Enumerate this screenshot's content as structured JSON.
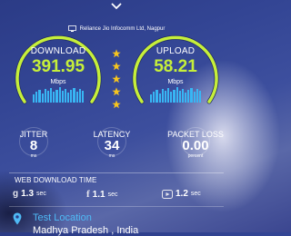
{
  "provider": {
    "name": "Reliance Jio Infocomm Ltd, Nagpur",
    "icon": "computer-icon"
  },
  "download": {
    "label": "DOWNLOAD",
    "value": "391.95",
    "unit": "Mbps",
    "color": "#c6ef3a"
  },
  "upload": {
    "label": "UPLOAD",
    "value": "58.21",
    "unit": "Mbps",
    "color": "#c6ef3a"
  },
  "rating": {
    "stars": 5,
    "color": "#f7c51e"
  },
  "metrics": {
    "jitter": {
      "label": "JITTER",
      "value": "8",
      "unit": "ms"
    },
    "latency": {
      "label": "LATENCY",
      "value": "34",
      "unit": "ms"
    },
    "packet_loss": {
      "label": "PACKET LOSS",
      "value": "0.00",
      "unit": "percent"
    }
  },
  "web_download": {
    "title": "WEB DOWNLOAD TIME",
    "items": [
      {
        "icon": "google-icon",
        "value": "1.3",
        "unit": "sec"
      },
      {
        "icon": "facebook-icon",
        "value": "1.1",
        "unit": "sec"
      },
      {
        "icon": "youtube-icon",
        "value": "1.2",
        "unit": "sec"
      }
    ]
  },
  "location": {
    "title": "Test Location",
    "value": "Madhya Pradesh , India",
    "icon": "location-pin-icon"
  },
  "colors": {
    "accent_green": "#c6ef3a",
    "accent_blue": "#38b6f4",
    "link_blue": "#4fb9f5"
  }
}
